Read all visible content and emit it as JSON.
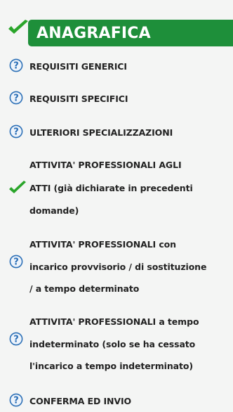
{
  "header": {
    "label": "ANAGRAFICA",
    "check_icon": "green-checkmark-icon"
  },
  "items": [
    {
      "icon": "help-icon",
      "lines": [
        "REQUISITI GENERICI"
      ]
    },
    {
      "icon": "help-icon",
      "lines": [
        "REQUISITI SPECIFICI"
      ]
    },
    {
      "icon": "help-icon",
      "lines": [
        "ULTERIORI SPECIALIZZAZIONI"
      ]
    },
    {
      "icon": "green-checkmark-icon",
      "lines": [
        "ATTIVITA' PROFESSIONALI AGLI",
        "ATTI (già dichiarate in precedenti",
        "domande)"
      ]
    },
    {
      "icon": "help-icon",
      "lines": [
        "ATTIVITA' PROFESSIONALI con",
        "incarico provvisorio / di sostituzione",
        "/ a tempo determinato"
      ]
    },
    {
      "icon": "help-icon",
      "lines": [
        "ATTIVITA' PROFESSIONALI a tempo",
        "indeterminato (solo se ha cessato",
        "l'incarico a tempo indeterminato)"
      ]
    },
    {
      "icon": "help-icon",
      "lines": [
        "CONFERMA ED INVIO"
      ]
    }
  ],
  "colors": {
    "header_bg": "#1e8f3a",
    "check_green": "#2aa52a",
    "help_blue": "#2b6fb6"
  }
}
